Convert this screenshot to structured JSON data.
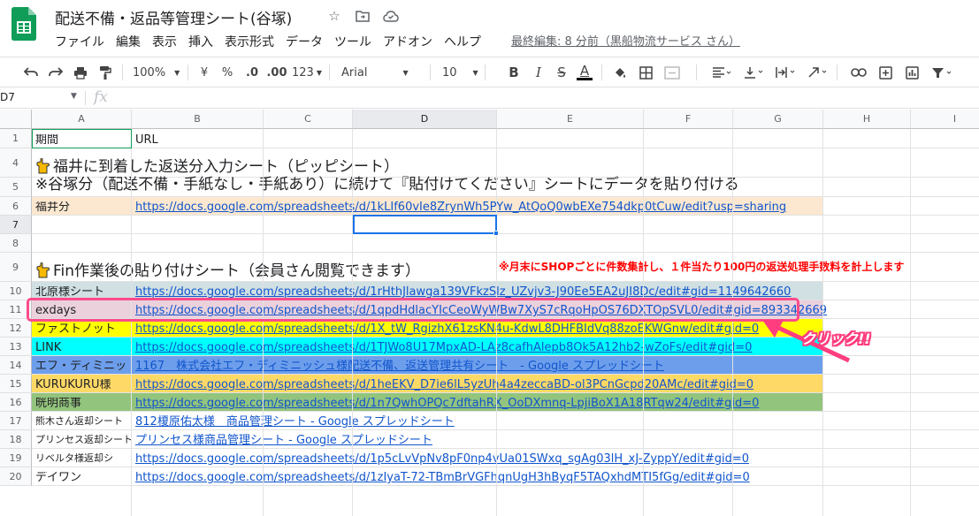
{
  "app": {
    "doc_title": "配送不備・返品等管理シート(谷塚)",
    "last_edit": "最終編集: 8 分前（黒船物流サービス さん）",
    "menu": [
      "ファイル",
      "編集",
      "表示",
      "挿入",
      "表示形式",
      "データ",
      "ツール",
      "アドオン",
      "ヘルプ"
    ]
  },
  "toolbar": {
    "zoom": "100%",
    "currency": "¥",
    "percent": "%",
    "decimal_less": ".0",
    "decimal_more": ".00",
    "number_format": "123",
    "font": "Arial",
    "font_size": "10",
    "bold": "B",
    "italic": "I",
    "strike": "S",
    "text_color": "A"
  },
  "formula_bar": {
    "name_box": "D7",
    "fx": "fx",
    "value": ""
  },
  "columns": [
    "A",
    "B",
    "C",
    "D",
    "E",
    "F",
    "G",
    "H",
    "I"
  ],
  "selected_column": "D",
  "selected_row": "7",
  "rows": [
    {
      "num": "1",
      "a": "期間",
      "b": "URL"
    },
    {
      "num": "4",
      "heading": "福井に到着した返送分入力シート（ピッピシート）"
    },
    {
      "num": "5",
      "heading": "※谷塚分（配送不備・手紙なし・手紙あり）に続けて『貼付けてください』シートにデータを貼り付ける"
    },
    {
      "num": "6",
      "a": "福井分",
      "b": "https://docs.google.com/spreadsheets/d/1kLIf60vIe8ZrynWh5PYw_AtQoQ0wbEXe754dkp0tCuw/edit?usp=sharing",
      "bg": "#fce8d0"
    },
    {
      "num": "7"
    },
    {
      "num": "8"
    },
    {
      "num": "9",
      "heading": "Fin作業後の貼り付けシート（会員さん閲覧できます）",
      "note": "※月末にSHOPごとに件数集計し、１件当たり100円の返送処理手数料を計上します"
    },
    {
      "num": "10",
      "a": "北原様シート",
      "b": "https://docs.google.com/spreadsheets/d/1rHthJlawga139VFkzSlz_UZvjv3-J90Ee5EA2uJI8Dc/edit#gid=1149642660",
      "bg": "#d0e0e3"
    },
    {
      "num": "11",
      "a": "exdays",
      "b": "https://docs.google.com/spreadsheets/d/1qpdHdlacYIcCeoWyWBw7XyS7cRqoHpOS76DXTOpSVL0/edit#gid=893342669",
      "bg": "#ead1dc"
    },
    {
      "num": "12",
      "a": "ファストノット",
      "b": "https://docs.google.com/spreadsheets/d/1X_tW_RgizhX61zsKN4u-KdwL8DHFBIdVq88zoEKWGnw/edit#gid=0",
      "bg": "#ffff00"
    },
    {
      "num": "13",
      "a": "LINK",
      "b": "https://docs.google.com/spreadsheets/d/1TJWo8U17MpxAD-LAz8cafhAlepb8Ok5A12hb2-wZoFs/edit#gid=0",
      "bg": "#00ffff"
    },
    {
      "num": "14",
      "a": "エフ・ディミニッ",
      "b": "1167　株式会社エフ・ディミニッシュ様配送不備、返送管理共有シート　- Google スプレッドシート",
      "bg": "#6d9eeb"
    },
    {
      "num": "15",
      "a": "KURUKURU様",
      "b": "https://docs.google.com/spreadsheets/d/1heEKV_D7ie6lL5yzUh4a4zeccaBD-ol3PCnGcpd20AMc/edit#gid=0",
      "bg": "#ffd966"
    },
    {
      "num": "16",
      "a": "晄明商事",
      "b": "https://docs.google.com/spreadsheets/d/1n7QwhOPQc7dftahRX_OoDXmnq-LpjiBoX1A18RTqw24/edit#gid=0",
      "bg": "#93c47d"
    },
    {
      "num": "17",
      "a": "熊木さん返却シート",
      "b": "812榎原佑太様　商品管理シート - Google スプレッドシート"
    },
    {
      "num": "18",
      "a": "プリンセス返却シート",
      "b": "プリンセス様商品管理シート - Google スプレッドシート"
    },
    {
      "num": "19",
      "a": "リベルタ様返却シ",
      "b": "https://docs.google.com/spreadsheets/d/1p5cLvVpNv8pF0np4vUa01SWxq_sgAg03lH_xJ-ZyppY/edit#gid=0"
    },
    {
      "num": "20",
      "a": "デイワン",
      "b": "https://docs.google.com/spreadsheets/d/1zIyaT-72-TBmBrVGFhqnUgH3hByqF5TAQxhdMTI5fGg/edit#gid=0"
    }
  ],
  "annotation": {
    "label": "クリック!!"
  }
}
